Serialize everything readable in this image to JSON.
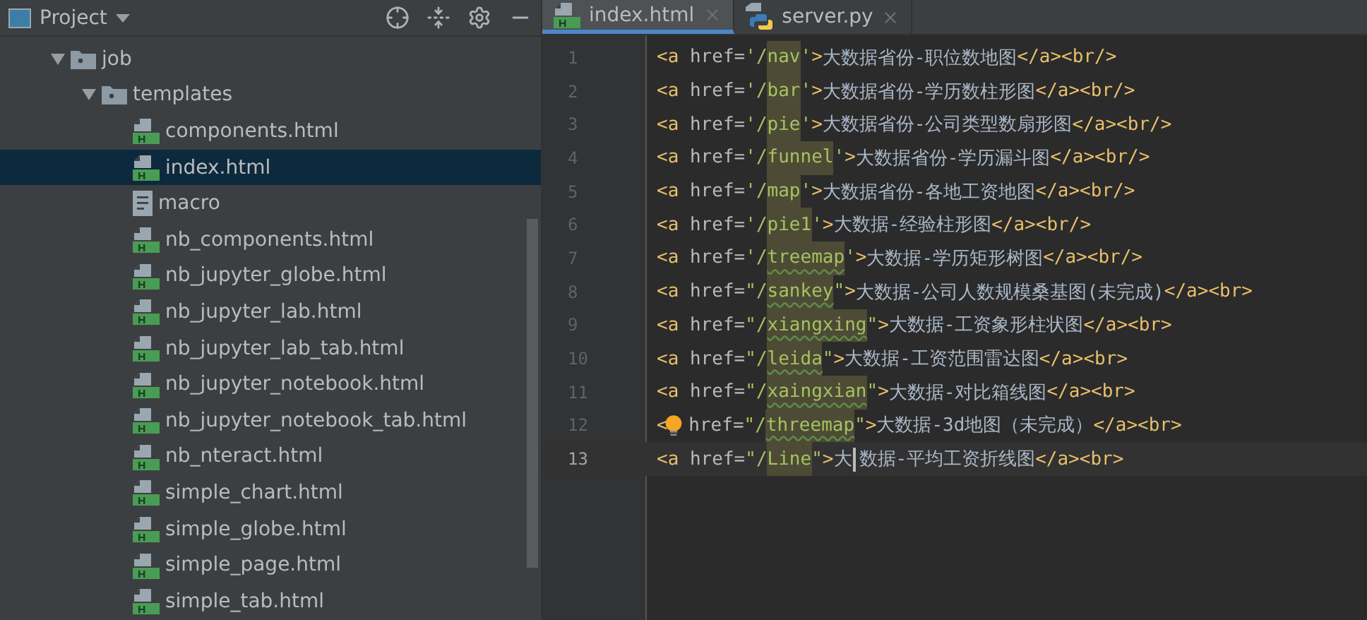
{
  "project_panel": {
    "title": "Project",
    "tree": [
      {
        "label": "job",
        "kind": "folder",
        "expanded": true,
        "selected": false,
        "children": [
          {
            "label": "templates",
            "kind": "folder",
            "expanded": true,
            "selected": false,
            "children": [
              {
                "label": "components.html",
                "kind": "html",
                "selected": false
              },
              {
                "label": "index.html",
                "kind": "html",
                "selected": true
              },
              {
                "label": "macro",
                "kind": "text",
                "selected": false
              },
              {
                "label": "nb_components.html",
                "kind": "html",
                "selected": false
              },
              {
                "label": "nb_jupyter_globe.html",
                "kind": "html",
                "selected": false
              },
              {
                "label": "nb_jupyter_lab.html",
                "kind": "html",
                "selected": false
              },
              {
                "label": "nb_jupyter_lab_tab.html",
                "kind": "html",
                "selected": false
              },
              {
                "label": "nb_jupyter_notebook.html",
                "kind": "html",
                "selected": false
              },
              {
                "label": "nb_jupyter_notebook_tab.html",
                "kind": "html",
                "selected": false
              },
              {
                "label": "nb_nteract.html",
                "kind": "html",
                "selected": false
              },
              {
                "label": "simple_chart.html",
                "kind": "html",
                "selected": false
              },
              {
                "label": "simple_globe.html",
                "kind": "html",
                "selected": false
              },
              {
                "label": "simple_page.html",
                "kind": "html",
                "selected": false
              },
              {
                "label": "simple_tab.html",
                "kind": "html",
                "selected": false
              }
            ]
          }
        ]
      }
    ]
  },
  "editor_tabs": [
    {
      "label": "index.html",
      "kind": "html",
      "selected": true
    },
    {
      "label": "server.py",
      "kind": "python",
      "selected": false
    }
  ],
  "code_lines": [
    {
      "number": "1",
      "warning": false,
      "current": false,
      "segments": [
        {
          "kind": "tag",
          "text": "<a"
        },
        {
          "kind": "attr",
          "text": " href="
        },
        {
          "kind": "value",
          "text": "'/"
        },
        {
          "kind": "path",
          "text": "nav"
        },
        {
          "kind": "value",
          "text": "'"
        },
        {
          "kind": "tag",
          "text": ">"
        },
        {
          "kind": "text",
          "text": "大数据省份-职位数地图"
        },
        {
          "kind": "tag",
          "text": "</a><br/>"
        }
      ]
    },
    {
      "number": "2",
      "warning": false,
      "current": false,
      "segments": [
        {
          "kind": "tag",
          "text": "<a"
        },
        {
          "kind": "attr",
          "text": " href="
        },
        {
          "kind": "value",
          "text": "'/"
        },
        {
          "kind": "path",
          "text": "bar"
        },
        {
          "kind": "value",
          "text": "'"
        },
        {
          "kind": "tag",
          "text": ">"
        },
        {
          "kind": "text",
          "text": "大数据省份-学历数柱形图"
        },
        {
          "kind": "tag",
          "text": "</a><br/>"
        }
      ]
    },
    {
      "number": "3",
      "warning": false,
      "current": false,
      "segments": [
        {
          "kind": "tag",
          "text": "<a"
        },
        {
          "kind": "attr",
          "text": " href="
        },
        {
          "kind": "value",
          "text": "'/"
        },
        {
          "kind": "path",
          "text": "pie"
        },
        {
          "kind": "value",
          "text": "'"
        },
        {
          "kind": "tag",
          "text": ">"
        },
        {
          "kind": "text",
          "text": "大数据省份-公司类型数扇形图"
        },
        {
          "kind": "tag",
          "text": "</a><br/>"
        }
      ]
    },
    {
      "number": "4",
      "warning": false,
      "current": false,
      "segments": [
        {
          "kind": "tag",
          "text": "<a"
        },
        {
          "kind": "attr",
          "text": " href="
        },
        {
          "kind": "value",
          "text": "'/"
        },
        {
          "kind": "path",
          "text": "funnel"
        },
        {
          "kind": "value",
          "text": "'"
        },
        {
          "kind": "tag",
          "text": ">"
        },
        {
          "kind": "text",
          "text": "大数据省份-学历漏斗图"
        },
        {
          "kind": "tag",
          "text": "</a><br/>"
        }
      ]
    },
    {
      "number": "5",
      "warning": false,
      "current": false,
      "segments": [
        {
          "kind": "tag",
          "text": "<a"
        },
        {
          "kind": "attr",
          "text": " href="
        },
        {
          "kind": "value",
          "text": "'/"
        },
        {
          "kind": "path",
          "text": "map"
        },
        {
          "kind": "value",
          "text": "'"
        },
        {
          "kind": "tag",
          "text": ">"
        },
        {
          "kind": "text",
          "text": "大数据省份-各地工资地图"
        },
        {
          "kind": "tag",
          "text": "</a><br/>"
        }
      ]
    },
    {
      "number": "6",
      "warning": false,
      "current": false,
      "segments": [
        {
          "kind": "tag",
          "text": "<a"
        },
        {
          "kind": "attr",
          "text": " href="
        },
        {
          "kind": "value",
          "text": "'/"
        },
        {
          "kind": "path",
          "text": "pie1"
        },
        {
          "kind": "value",
          "text": "'"
        },
        {
          "kind": "tag",
          "text": ">"
        },
        {
          "kind": "text",
          "text": "大数据-经验柱形图"
        },
        {
          "kind": "tag",
          "text": "</a><br/>"
        }
      ]
    },
    {
      "number": "7",
      "warning": true,
      "current": false,
      "segments": [
        {
          "kind": "tag",
          "text": "<a"
        },
        {
          "kind": "attr",
          "text": " href="
        },
        {
          "kind": "value",
          "text": "'/"
        },
        {
          "kind": "path",
          "text": "treemap"
        },
        {
          "kind": "value",
          "text": "'"
        },
        {
          "kind": "tag",
          "text": ">"
        },
        {
          "kind": "text",
          "text": "大数据-学历矩形树图"
        },
        {
          "kind": "tag",
          "text": "</a><br/>"
        }
      ]
    },
    {
      "number": "8",
      "warning": true,
      "current": false,
      "segments": [
        {
          "kind": "tag",
          "text": "<a"
        },
        {
          "kind": "attr",
          "text": " href="
        },
        {
          "kind": "value",
          "text": "\"/"
        },
        {
          "kind": "path",
          "text": "sankey"
        },
        {
          "kind": "value",
          "text": "\""
        },
        {
          "kind": "tag",
          "text": ">"
        },
        {
          "kind": "text",
          "text": "大数据-公司人数规模桑基图(未完成)"
        },
        {
          "kind": "tag",
          "text": "</a><br>"
        }
      ]
    },
    {
      "number": "9",
      "warning": true,
      "current": false,
      "segments": [
        {
          "kind": "tag",
          "text": "<a"
        },
        {
          "kind": "attr",
          "text": " href="
        },
        {
          "kind": "value",
          "text": "\"/"
        },
        {
          "kind": "path",
          "text": "xiangxing"
        },
        {
          "kind": "value",
          "text": "\""
        },
        {
          "kind": "tag",
          "text": ">"
        },
        {
          "kind": "text",
          "text": "大数据-工资象形柱状图"
        },
        {
          "kind": "tag",
          "text": "</a><br>"
        }
      ]
    },
    {
      "number": "10",
      "warning": true,
      "current": false,
      "segments": [
        {
          "kind": "tag",
          "text": "<a"
        },
        {
          "kind": "attr",
          "text": " href="
        },
        {
          "kind": "value",
          "text": "\"/"
        },
        {
          "kind": "path",
          "text": "leida"
        },
        {
          "kind": "value",
          "text": "\""
        },
        {
          "kind": "tag",
          "text": ">"
        },
        {
          "kind": "text",
          "text": "大数据-工资范围雷达图"
        },
        {
          "kind": "tag",
          "text": "</a><br>"
        }
      ]
    },
    {
      "number": "11",
      "warning": true,
      "current": false,
      "segments": [
        {
          "kind": "tag",
          "text": "<a"
        },
        {
          "kind": "attr",
          "text": " href="
        },
        {
          "kind": "value",
          "text": "\"/"
        },
        {
          "kind": "path",
          "text": "xaingxian"
        },
        {
          "kind": "value",
          "text": "\""
        },
        {
          "kind": "tag",
          "text": ">"
        },
        {
          "kind": "text",
          "text": "大数据-对比箱线图"
        },
        {
          "kind": "tag",
          "text": "</a><br>"
        }
      ]
    },
    {
      "number": "12",
      "warning": true,
      "current": false,
      "bulb": true,
      "segments": [
        {
          "kind": "tag",
          "text": "<"
        },
        {
          "kind": "attr",
          "text": " href="
        },
        {
          "kind": "value",
          "text": "\"/"
        },
        {
          "kind": "path",
          "text": "threemap"
        },
        {
          "kind": "value",
          "text": "\""
        },
        {
          "kind": "tag",
          "text": ">"
        },
        {
          "kind": "text",
          "text": "大数据-3d地图（未完成）"
        },
        {
          "kind": "tag",
          "text": "</a><br>"
        }
      ]
    },
    {
      "number": "13",
      "warning": false,
      "current": true,
      "segments": [
        {
          "kind": "tag",
          "text": "<a"
        },
        {
          "kind": "attr",
          "text": " href="
        },
        {
          "kind": "value",
          "text": "\"/"
        },
        {
          "kind": "path",
          "text": "Line"
        },
        {
          "kind": "value",
          "text": "\""
        },
        {
          "kind": "tag",
          "text": ">"
        },
        {
          "kind": "text",
          "text": "大"
        },
        {
          "kind": "caret"
        },
        {
          "kind": "text",
          "text": "数据-平均工资折线图"
        },
        {
          "kind": "tag",
          "text": "</a><br>"
        }
      ]
    }
  ]
}
